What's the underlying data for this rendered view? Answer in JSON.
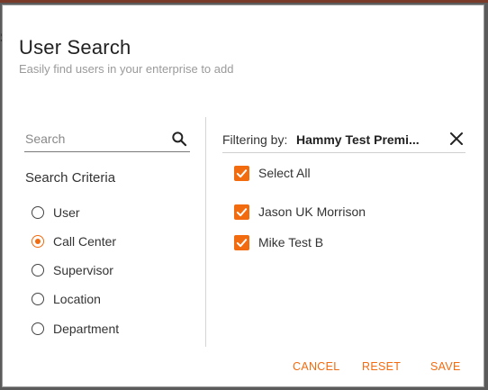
{
  "backdrop": {
    "fragment": "S"
  },
  "dialog": {
    "title": "User Search",
    "subtitle": "Easily find users in your enterprise to add"
  },
  "search": {
    "placeholder": "Search",
    "value": "",
    "icon": "search-icon"
  },
  "criteria": {
    "heading": "Search Criteria",
    "options": [
      {
        "label": "User",
        "checked": false
      },
      {
        "label": "Call Center",
        "checked": true
      },
      {
        "label": "Supervisor",
        "checked": false
      },
      {
        "label": "Location",
        "checked": false
      },
      {
        "label": "Department",
        "checked": false
      }
    ]
  },
  "filter": {
    "label": "Filtering by:",
    "value": "Hammy Test Premi...",
    "clear_icon": "close-icon"
  },
  "results": {
    "select_all": {
      "label": "Select All",
      "checked": true
    },
    "items": [
      {
        "label": "Jason UK Morrison",
        "checked": true
      },
      {
        "label": "Mike Test B",
        "checked": true
      }
    ]
  },
  "actions": {
    "cancel": "CANCEL",
    "reset": "RESET",
    "save": "SAVE"
  },
  "colors": {
    "accent": "#f26b0f",
    "backdrop": "#5b5b5b"
  }
}
